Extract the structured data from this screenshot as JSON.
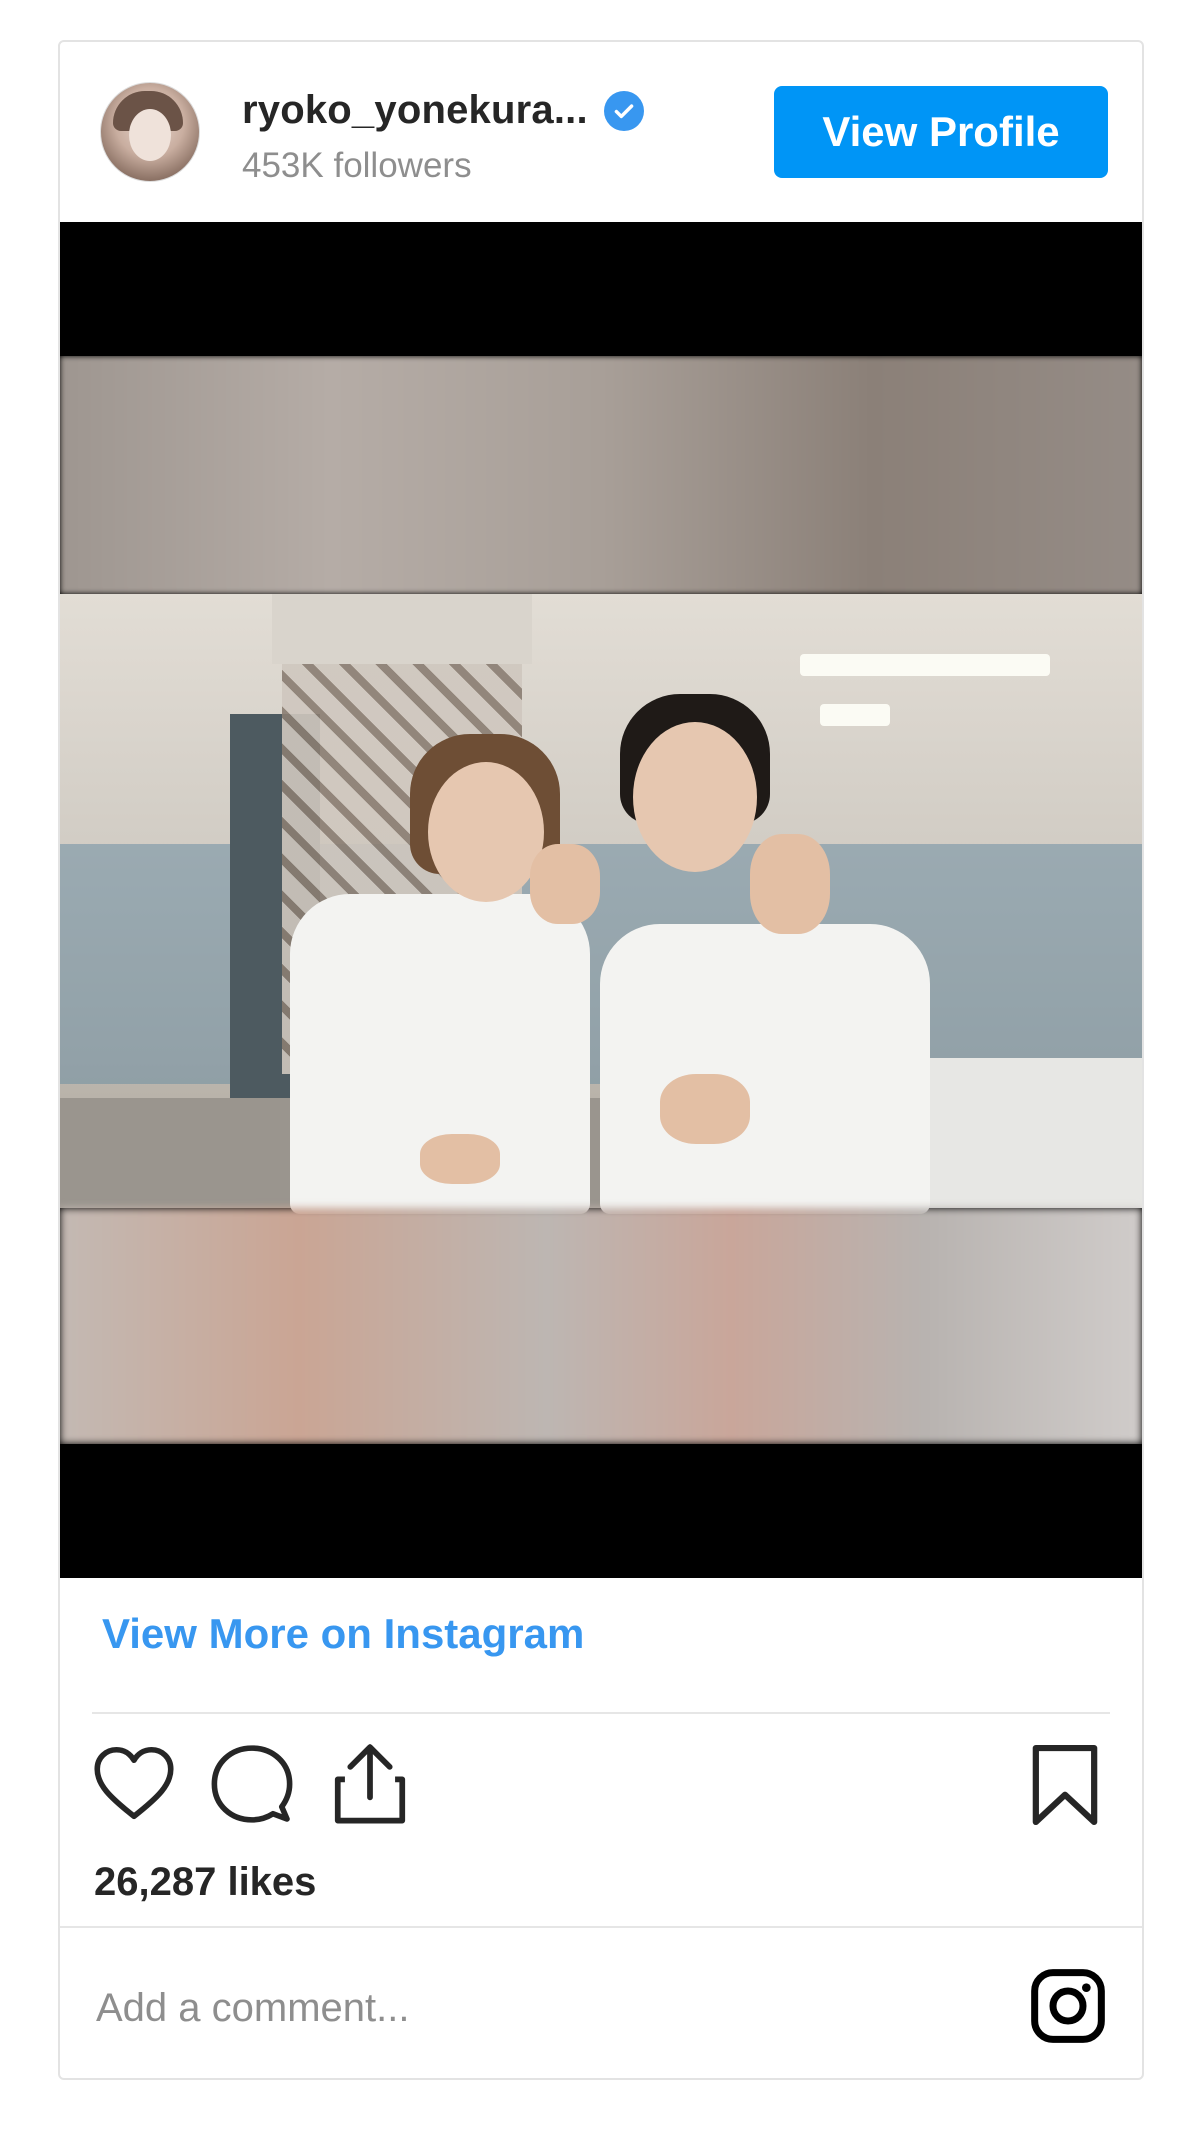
{
  "header": {
    "username": "ryoko_yonekura...",
    "followers": "453K followers",
    "view_profile_label": "View Profile"
  },
  "footer": {
    "view_more_label": "View More on Instagram",
    "likes": "26,287 likes",
    "comment_placeholder": "Add a comment..."
  },
  "icons": {
    "verified": "verified-badge-icon",
    "like": "heart-icon",
    "comment": "comment-bubble-icon",
    "share": "share-icon",
    "save": "bookmark-icon",
    "instagram": "instagram-logo-icon"
  },
  "colors": {
    "accent": "#0095f6",
    "link": "#3897f0",
    "text": "#262626",
    "muted": "#8e8e8e"
  }
}
